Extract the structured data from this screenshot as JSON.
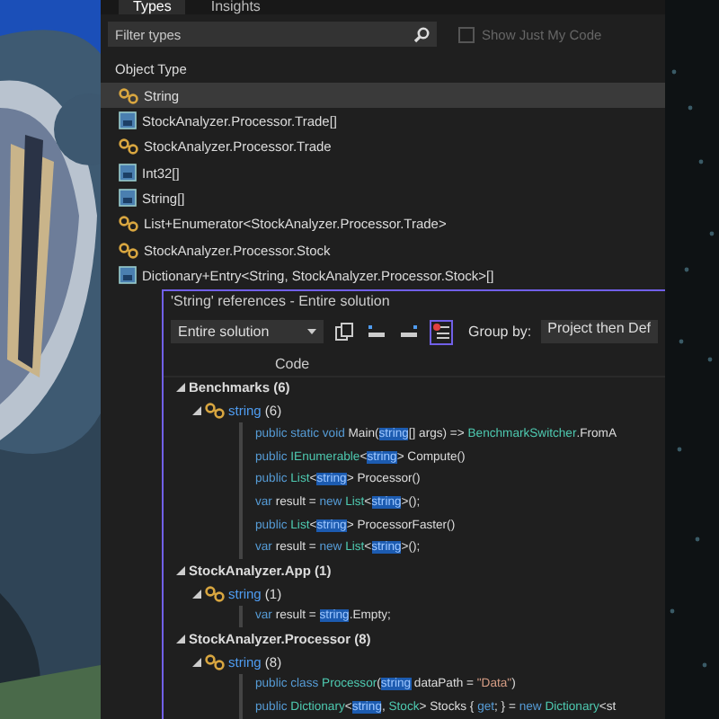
{
  "tabs": [
    {
      "label": "Types",
      "selected": true
    },
    {
      "label": "Insights",
      "selected": false
    }
  ],
  "filter": {
    "placeholder": "Filter types"
  },
  "just_my_code": {
    "label": "Show Just My Code",
    "checked": false,
    "disabled": true
  },
  "object_list": {
    "header": "Object Type",
    "rows": [
      {
        "name": "String",
        "kind": "class",
        "selected": true
      },
      {
        "name": "StockAnalyzer.Processor.Trade[]",
        "kind": "array",
        "selected": false
      },
      {
        "name": "StockAnalyzer.Processor.Trade",
        "kind": "class",
        "selected": false
      },
      {
        "name": "Int32[]",
        "kind": "array",
        "selected": false
      },
      {
        "name": "String[]",
        "kind": "array",
        "selected": false
      },
      {
        "name": "List+Enumerator<StockAnalyzer.Processor.Trade>",
        "kind": "class",
        "selected": false
      },
      {
        "name": "StockAnalyzer.Processor.Stock",
        "kind": "class",
        "selected": false
      },
      {
        "name": "Dictionary+Entry<String, StockAnalyzer.Processor.Stock>[]",
        "kind": "array",
        "selected": false
      }
    ]
  },
  "references": {
    "title": "'String' references - Entire solution",
    "scope": "Entire solution",
    "group_by_label": "Group by:",
    "group_by": "Project then Def",
    "column": "Code",
    "tree": [
      {
        "label": "Benchmarks (6)",
        "expanded": true,
        "children": [
          {
            "name": "string",
            "count": "(6)",
            "expanded": true,
            "lines": [
              [
                {
                  "text": "public static void ",
                  "kind": "keyword"
                },
                {
                  "text": "Main(",
                  "kind": "plain"
                },
                {
                  "text": "string",
                  "kind": "match"
                },
                {
                  "text": "[] args) => ",
                  "kind": "plain"
                },
                {
                  "text": "BenchmarkSwitcher",
                  "kind": "type"
                },
                {
                  "text": ".FromA",
                  "kind": "plain"
                }
              ],
              [
                {
                  "text": "public ",
                  "kind": "keyword"
                },
                {
                  "text": "IEnumerable",
                  "kind": "type"
                },
                {
                  "text": "<",
                  "kind": "plain"
                },
                {
                  "text": "string",
                  "kind": "match"
                },
                {
                  "text": "> Compute()",
                  "kind": "plain"
                }
              ],
              [
                {
                  "text": "public ",
                  "kind": "keyword"
                },
                {
                  "text": "List",
                  "kind": "type"
                },
                {
                  "text": "<",
                  "kind": "plain"
                },
                {
                  "text": "string",
                  "kind": "match"
                },
                {
                  "text": "> Processor()",
                  "kind": "plain"
                }
              ],
              [
                {
                  "text": "var ",
                  "kind": "keyword"
                },
                {
                  "text": "result = ",
                  "kind": "plain"
                },
                {
                  "text": "new ",
                  "kind": "keyword"
                },
                {
                  "text": "List",
                  "kind": "type"
                },
                {
                  "text": "<",
                  "kind": "plain"
                },
                {
                  "text": "string",
                  "kind": "match"
                },
                {
                  "text": ">();",
                  "kind": "plain"
                }
              ],
              [
                {
                  "text": "public ",
                  "kind": "keyword"
                },
                {
                  "text": "List",
                  "kind": "type"
                },
                {
                  "text": "<",
                  "kind": "plain"
                },
                {
                  "text": "string",
                  "kind": "match"
                },
                {
                  "text": "> ProcessorFaster()",
                  "kind": "plain"
                }
              ],
              [
                {
                  "text": "var ",
                  "kind": "keyword"
                },
                {
                  "text": "result = ",
                  "kind": "plain"
                },
                {
                  "text": "new ",
                  "kind": "keyword"
                },
                {
                  "text": "List",
                  "kind": "type"
                },
                {
                  "text": "<",
                  "kind": "plain"
                },
                {
                  "text": "string",
                  "kind": "match"
                },
                {
                  "text": ">();",
                  "kind": "plain"
                }
              ]
            ]
          }
        ]
      },
      {
        "label": "StockAnalyzer.App (1)",
        "expanded": true,
        "children": [
          {
            "name": "string",
            "count": "(1)",
            "expanded": true,
            "lines": [
              [
                {
                  "text": "var ",
                  "kind": "keyword"
                },
                {
                  "text": "result = ",
                  "kind": "plain"
                },
                {
                  "text": "string",
                  "kind": "match"
                },
                {
                  "text": ".Empty;",
                  "kind": "plain"
                }
              ]
            ]
          }
        ]
      },
      {
        "label": "StockAnalyzer.Processor (8)",
        "expanded": true,
        "children": [
          {
            "name": "string",
            "count": "(8)",
            "expanded": true,
            "lines": [
              [
                {
                  "text": "public class ",
                  "kind": "keyword"
                },
                {
                  "text": "Processor",
                  "kind": "type"
                },
                {
                  "text": "(",
                  "kind": "plain"
                },
                {
                  "text": "string",
                  "kind": "match"
                },
                {
                  "text": " dataPath = ",
                  "kind": "plain"
                },
                {
                  "text": "\"Data\"",
                  "kind": "literal"
                },
                {
                  "text": ")",
                  "kind": "plain"
                }
              ],
              [
                {
                  "text": "public ",
                  "kind": "keyword"
                },
                {
                  "text": "Dictionary",
                  "kind": "type"
                },
                {
                  "text": "<",
                  "kind": "plain"
                },
                {
                  "text": "string",
                  "kind": "match"
                },
                {
                  "text": ", ",
                  "kind": "plain"
                },
                {
                  "text": "Stock",
                  "kind": "type"
                },
                {
                  "text": "> Stocks { ",
                  "kind": "plain"
                },
                {
                  "text": "get",
                  "kind": "keyword"
                },
                {
                  "text": "; } = ",
                  "kind": "plain"
                },
                {
                  "text": "new ",
                  "kind": "keyword"
                },
                {
                  "text": "Dictionary",
                  "kind": "type"
                },
                {
                  "text": "<st",
                  "kind": "plain"
                }
              ]
            ]
          }
        ]
      }
    ]
  }
}
